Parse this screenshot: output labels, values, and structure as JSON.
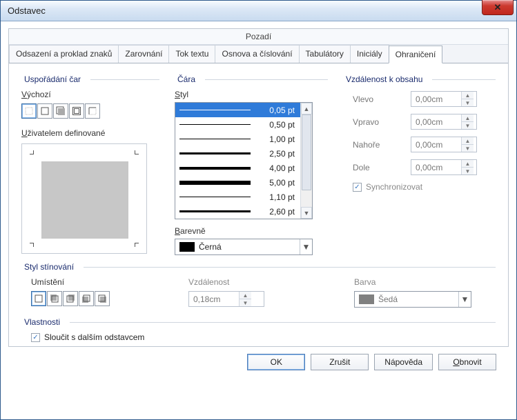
{
  "window": {
    "title": "Odstavec"
  },
  "subheader": "Pozadí",
  "tabs": [
    "Odsazení a proklad znaků",
    "Zarovnání",
    "Tok textu",
    "Osnova a číslování",
    "Tabulátory",
    "Iniciály",
    "Ohraničení"
  ],
  "active_tab": 6,
  "arrangement": {
    "legend": "Uspořádání čar",
    "default_label": "Výchozí",
    "userdef_label": "Uživatelem definované"
  },
  "line": {
    "legend": "Čára",
    "style_label": "Styl",
    "styles": [
      "0,05 pt",
      "0,50 pt",
      "1,00 pt",
      "2,50 pt",
      "4,00 pt",
      "5,00 pt",
      "1,10 pt",
      "2,60 pt"
    ],
    "selected_style": 0,
    "color_label": "Barevně",
    "color_value": "Černá"
  },
  "spacing": {
    "legend": "Vzdálenost k obsahu",
    "left_label": "Vlevo",
    "left_value": "0,00cm",
    "right_label": "Vpravo",
    "right_value": "0,00cm",
    "top_label": "Nahoře",
    "top_value": "0,00cm",
    "bottom_label": "Dole",
    "bottom_value": "0,00cm",
    "sync_label": "Synchronizovat",
    "sync_checked": true
  },
  "shadow": {
    "legend": "Styl stínování",
    "pos_label": "Umístění",
    "dist_label": "Vzdálenost",
    "dist_value": "0,18cm",
    "color_label": "Barva",
    "color_value": "Šedá"
  },
  "properties": {
    "legend": "Vlastnosti",
    "merge_label": "Sloučit s dalším odstavcem",
    "merge_checked": true
  },
  "buttons": {
    "ok": "OK",
    "cancel": "Zrušit",
    "help": "Nápověda",
    "reset": "Obnovit"
  }
}
